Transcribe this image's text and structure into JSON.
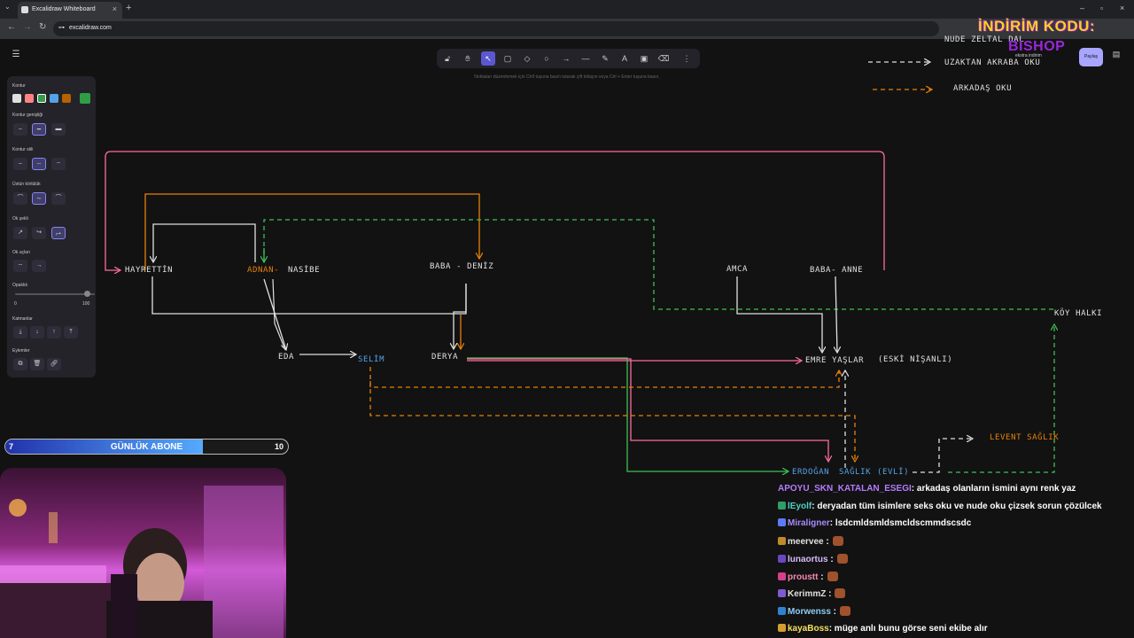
{
  "browser": {
    "tab_title": "Excalidraw Whiteboard",
    "url": "excalidraw.com"
  },
  "toolbar": {
    "tools": [
      "lock-icon",
      "hand-icon",
      "pointer-icon",
      "rectangle-icon",
      "diamond-icon",
      "ellipse-icon",
      "arrow-icon",
      "line-icon",
      "pencil-icon",
      "text-icon",
      "image-icon",
      "eraser-icon",
      "more-icon"
    ],
    "active": "pointer-icon",
    "hint": "Noktaları düzenlemek için CtrlI tuşuna basılı tutarak çift tıklayın veya Ctrl + Enter tuşuna basın."
  },
  "props": {
    "stroke_label": "Kontur",
    "stroke_colors": [
      "#e0e0e0",
      "#ff8383",
      "#3a994c",
      "#56a2e8",
      "#b76100",
      "#2f9e44"
    ],
    "stroke_width_label": "Kontur genişliği",
    "stroke_style_label": "Kontur stili",
    "sloppiness_label": "Üstün körlülük",
    "arrow_type_label": "Ok şekli",
    "arrowheads_label": "Ok uçları",
    "opacity_label": "Opaklık",
    "opacity_min": "0",
    "opacity_max": "100",
    "layers_label": "Katmanlar",
    "actions_label": "Eylemler"
  },
  "right_top": {
    "share_label": "Paylaş",
    "promo_line1": "İNDİRİM KODU:",
    "promo_line2": "BISHOP",
    "promo_line3": "ekstra indirim"
  },
  "legend": {
    "partial_top": "NUDE ZELTAL DAL",
    "remote_relative": "UZAKTAN AKRABA OKU",
    "friend": "ARKADAŞ OKU"
  },
  "diagram": {
    "hayrettin": "HAYRETTİN",
    "adnan": "ADNAN-",
    "nasibe": "NASİBE",
    "baba_deniz": "BABA - DENİZ",
    "amca": "AMCA",
    "baba_anne": "BABA- ANNE",
    "koy_halki": "KÖY HALKI",
    "eda": "EDA",
    "selim": "SELİM",
    "derya": "DERYA",
    "emre": "EMRE YAŞLAR",
    "eski": "(ESKİ NİŞANLI)",
    "erdogan": "ERDOĞAN",
    "saglik": "SAĞLIK",
    "evli": "(EVLİ)",
    "levent": "LEVENT SAĞLIK"
  },
  "sub_goal": {
    "label": "GÜNLÜK ABONE",
    "current": 7,
    "current_text": "7",
    "target": 10,
    "target_text": "10"
  },
  "chat": [
    {
      "user": "APOYU_SKN_KATALAN_ESEGI",
      "color": "#b57cff",
      "text": ": arkadaş olanların ismini aynı renk yaz"
    },
    {
      "user": "lEyolf",
      "color": "#4fd1c5",
      "text": ": deryadan tüm isimlere seks oku ve nude oku çizsek sorun çözülcek"
    },
    {
      "user": "Miraligner",
      "color": "#a78bfa",
      "text": ": lsdcmldsmldsmcldscmmdscsdc"
    },
    {
      "user": "meervee",
      "color": "#e0e0e0",
      "text": " :"
    },
    {
      "user": "lunaortus",
      "color": "#d6bcfa",
      "text": " :"
    },
    {
      "user": "proustt",
      "color": "#f687b3",
      "text": " :"
    },
    {
      "user": "KerimmZ",
      "color": "#e0e0e0",
      "text": " :"
    },
    {
      "user": "Morwenss",
      "color": "#90cdf4",
      "text": " :"
    },
    {
      "user": "kayaBoss",
      "color": "#f6e05e",
      "text": ": müge anlı bunu görse seni ekibe alır"
    }
  ]
}
